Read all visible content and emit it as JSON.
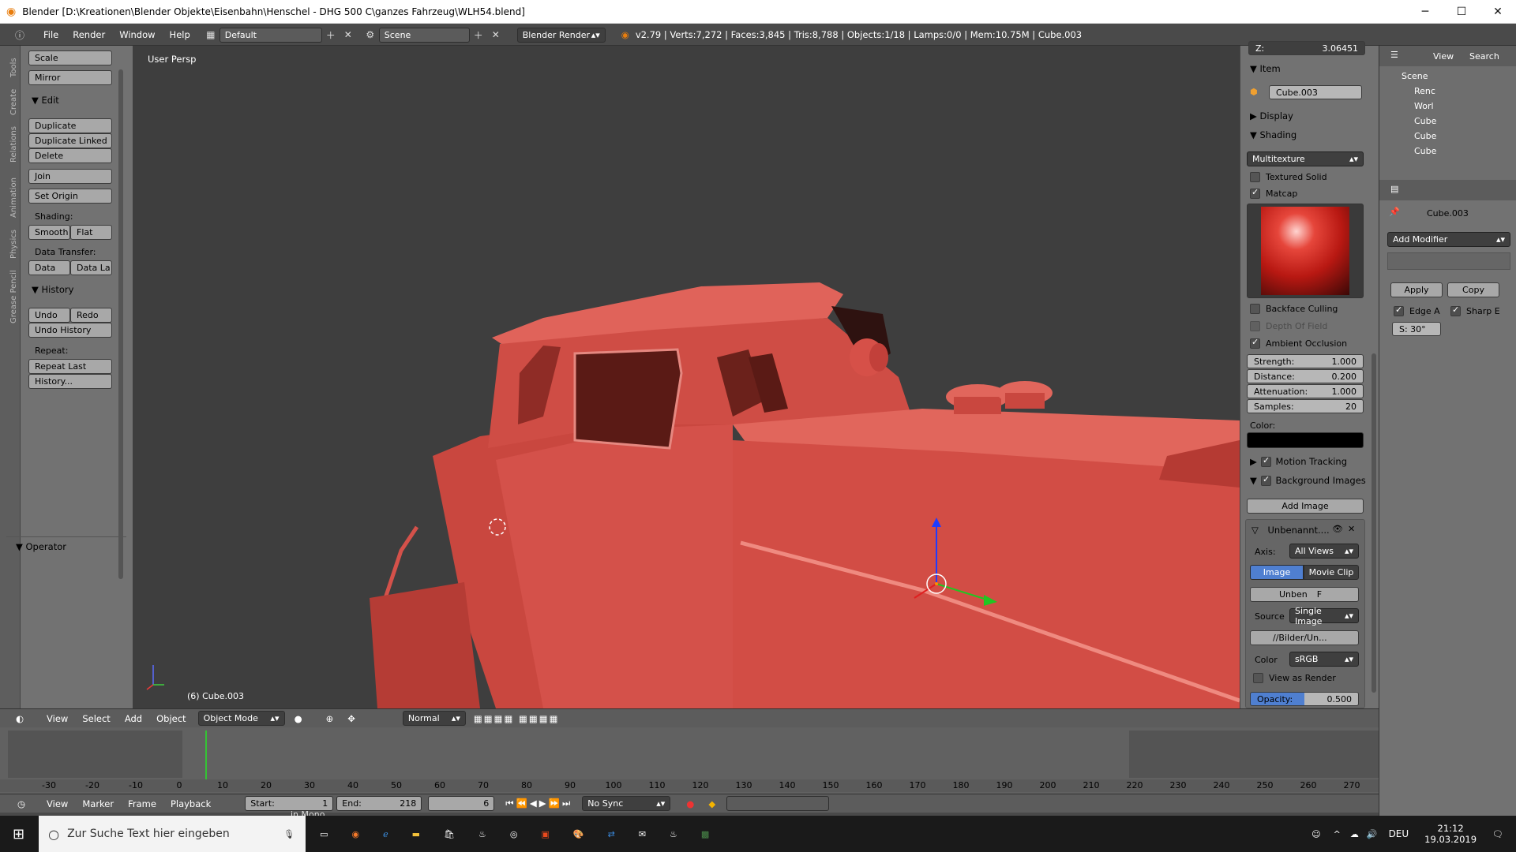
{
  "window": {
    "title": "Blender [D:\\Kreationen\\Blender Objekte\\Eisenbahn\\Henschel - DHG 500 C\\ganzes Fahrzeug\\WLH54.blend]"
  },
  "menu": {
    "file": "File",
    "render": "Render",
    "window": "Window",
    "help": "Help"
  },
  "layout_field": "Default",
  "scene_field": "Scene",
  "engine": "Blender Render",
  "stats": "v2.79 | Verts:7,272 | Faces:3,845 | Tris:8,788 | Objects:1/18 | Lamps:0/0 | Mem:10.75M | Cube.003",
  "tools": {
    "scale": "Scale",
    "mirror": "Mirror",
    "edit_header": "Edit",
    "duplicate": "Duplicate",
    "duplicate_linked": "Duplicate Linked",
    "delete": "Delete",
    "join": "Join",
    "set_origin": "Set Origin",
    "shading_label": "Shading:",
    "smooth": "Smooth",
    "flat": "Flat",
    "data_transfer": "Data Transfer:",
    "data": "Data",
    "data_la": "Data La",
    "history_header": "History",
    "undo": "Undo",
    "redo": "Redo",
    "undo_history": "Undo History",
    "repeat_label": "Repeat:",
    "repeat_last": "Repeat Last",
    "history_btn": "History...",
    "operator_header": "Operator"
  },
  "vtabs": [
    "Tools",
    "Create",
    "Relations",
    "Animation",
    "Physics",
    "Grease Pencil"
  ],
  "viewport": {
    "label": "User Persp",
    "object_label": "(6) Cube.003"
  },
  "props": {
    "z_label": "Z:",
    "z_value": "3.06451",
    "item_header": "Item",
    "item_name": "Cube.003",
    "display": "Display",
    "shading": "Shading",
    "multitexture": "Multitexture",
    "textured_solid": "Textured Solid",
    "matcap": "Matcap",
    "backface": "Backface Culling",
    "dof": "Depth Of Field",
    "ao": "Ambient Occlusion",
    "strength_l": "Strength:",
    "strength_v": "1.000",
    "distance_l": "Distance:",
    "distance_v": "0.200",
    "atten_l": "Attenuation:",
    "atten_v": "1.000",
    "samples_l": "Samples:",
    "samples_v": "20",
    "color_l": "Color:",
    "motion_tracking": "Motion Tracking",
    "bg_images": "Background Images",
    "add_image": "Add Image",
    "unbenannt": "Unbenannt....",
    "axis_l": "Axis:",
    "axis_v": "All Views",
    "image_tab": "Image",
    "movie_tab": "Movie Clip",
    "unben": "Unben",
    "f": "F",
    "source_l": "Source",
    "source_v": "Single Image",
    "path": "//Bilder/Un...",
    "color2_l": "Color",
    "color2_v": "sRGB",
    "view_as_render": "View as Render",
    "opacity_l": "Opacity:",
    "opacity_v": "0.500"
  },
  "outliner": {
    "view": "View",
    "search": "Search",
    "scene": "Scene",
    "items": [
      "Renc",
      "Worl",
      "Cube",
      "Cube",
      "Cube"
    ]
  },
  "modifiers": {
    "object": "Cube.003",
    "add_modifier": "Add Modifier",
    "apply": "Apply",
    "copy": "Copy",
    "edge_a": "Edge A",
    "sharp_e": "Sharp E",
    "angle": "S: 30°"
  },
  "view_header": {
    "view": "View",
    "select": "Select",
    "add": "Add",
    "object": "Object",
    "mode": "Object Mode",
    "pivot": "Normal"
  },
  "timeline": {
    "ticks": [
      "-30",
      "-20",
      "-10",
      "0",
      "10",
      "20",
      "30",
      "40",
      "50",
      "60",
      "70",
      "80",
      "90",
      "100",
      "110",
      "120",
      "130",
      "140",
      "150",
      "160",
      "170",
      "180",
      "190",
      "200",
      "210",
      "220",
      "230",
      "240",
      "250",
      "260",
      "270"
    ],
    "current_frame": 6
  },
  "timeline_header": {
    "view": "View",
    "marker": "Marker",
    "frame": "Frame",
    "playback": "Playback",
    "start_l": "Start:",
    "start_v": "1",
    "end_l": "End:",
    "end_v": "218",
    "current": "6",
    "sync": "No Sync"
  },
  "statusline": "in Mono.",
  "taskbar": {
    "search": "Zur Suche Text hier eingeben",
    "lang": "DEU",
    "time": "21:12",
    "date": "19.03.2019"
  },
  "colors": {
    "model": "#d9534a",
    "viewport_bg": "#3e3e3e",
    "panel": "#727272",
    "accent_blue": "#4f7fd0"
  }
}
